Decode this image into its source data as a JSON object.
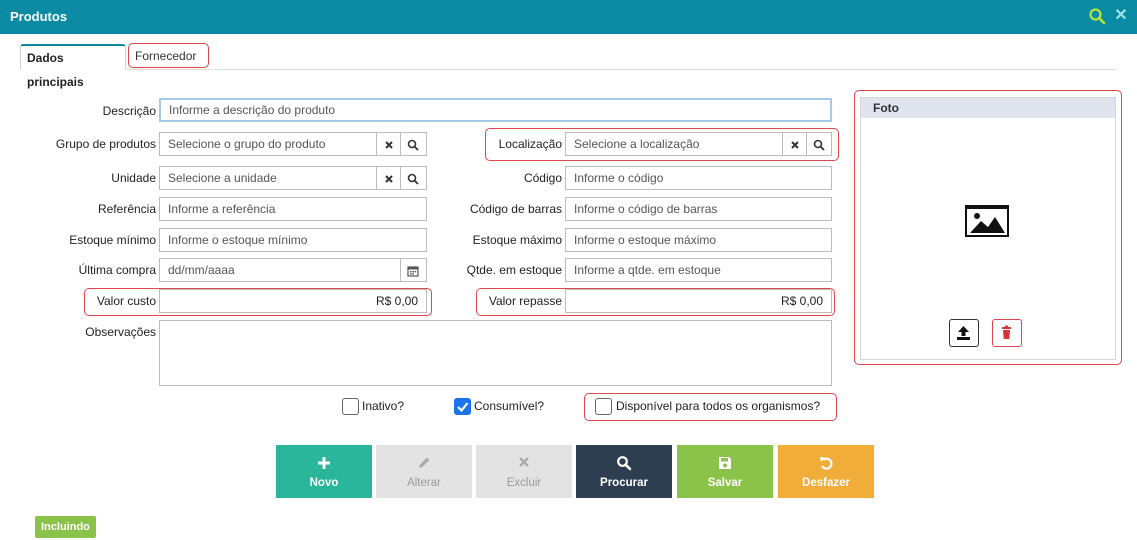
{
  "window": {
    "title": "Produtos",
    "search_icon": "search-icon",
    "close_icon": "close-icon"
  },
  "tabs": [
    {
      "label": "Dados principais",
      "active": true
    },
    {
      "label": "Fornecedor",
      "active": false
    }
  ],
  "form": {
    "descricao": {
      "label": "Descrição",
      "placeholder": "Informe a descrição do produto"
    },
    "grupo": {
      "label": "Grupo de produtos",
      "placeholder": "Selecione o grupo do produto"
    },
    "localizacao": {
      "label": "Localização",
      "placeholder": "Selecione a localização"
    },
    "unidade": {
      "label": "Unidade",
      "placeholder": "Selecione a unidade"
    },
    "codigo": {
      "label": "Código",
      "placeholder": "Informe o código"
    },
    "referencia": {
      "label": "Referência",
      "placeholder": "Informe a referência"
    },
    "codigo_barras": {
      "label": "Código de barras",
      "placeholder": "Informe o código de barras"
    },
    "estoque_minimo": {
      "label": "Estoque mínimo",
      "placeholder": "Informe o estoque mínimo"
    },
    "estoque_maximo": {
      "label": "Estoque máximo",
      "placeholder": "Informe o estoque máximo"
    },
    "ultima_compra": {
      "label": "Última compra",
      "placeholder": "dd/mm/aaaa"
    },
    "qtde_estoque": {
      "label": "Qtde. em estoque",
      "placeholder": "Informe a qtde. em estoque"
    },
    "valor_custo": {
      "label": "Valor custo",
      "value": "R$ 0,00"
    },
    "valor_repasse": {
      "label": "Valor repasse",
      "value": "R$ 0,00"
    },
    "observacoes": {
      "label": "Observações",
      "value": ""
    }
  },
  "checkboxes": [
    {
      "label": "Inativo?",
      "checked": false
    },
    {
      "label": "Consumível?",
      "checked": true
    },
    {
      "label": "Disponível para todos os organismos?",
      "checked": false
    }
  ],
  "foto": {
    "header": "Foto"
  },
  "actions": [
    {
      "label": "Novo",
      "icon": "plus-icon",
      "enabled": true
    },
    {
      "label": "Alterar",
      "icon": "pencil-icon",
      "enabled": false
    },
    {
      "label": "Excluir",
      "icon": "x-icon",
      "enabled": false
    },
    {
      "label": "Procurar",
      "icon": "search-icon",
      "enabled": true
    },
    {
      "label": "Salvar",
      "icon": "save-icon",
      "enabled": true
    },
    {
      "label": "Desfazer",
      "icon": "undo-icon",
      "enabled": true
    }
  ],
  "status": "Incluindo",
  "colors": {
    "header": "#0b8aa3",
    "highlight": "#e0474c",
    "novo": "#2ab69b",
    "procurar": "#2c3e50",
    "salvar": "#8bc34a",
    "desfazer": "#f0ad3a"
  }
}
